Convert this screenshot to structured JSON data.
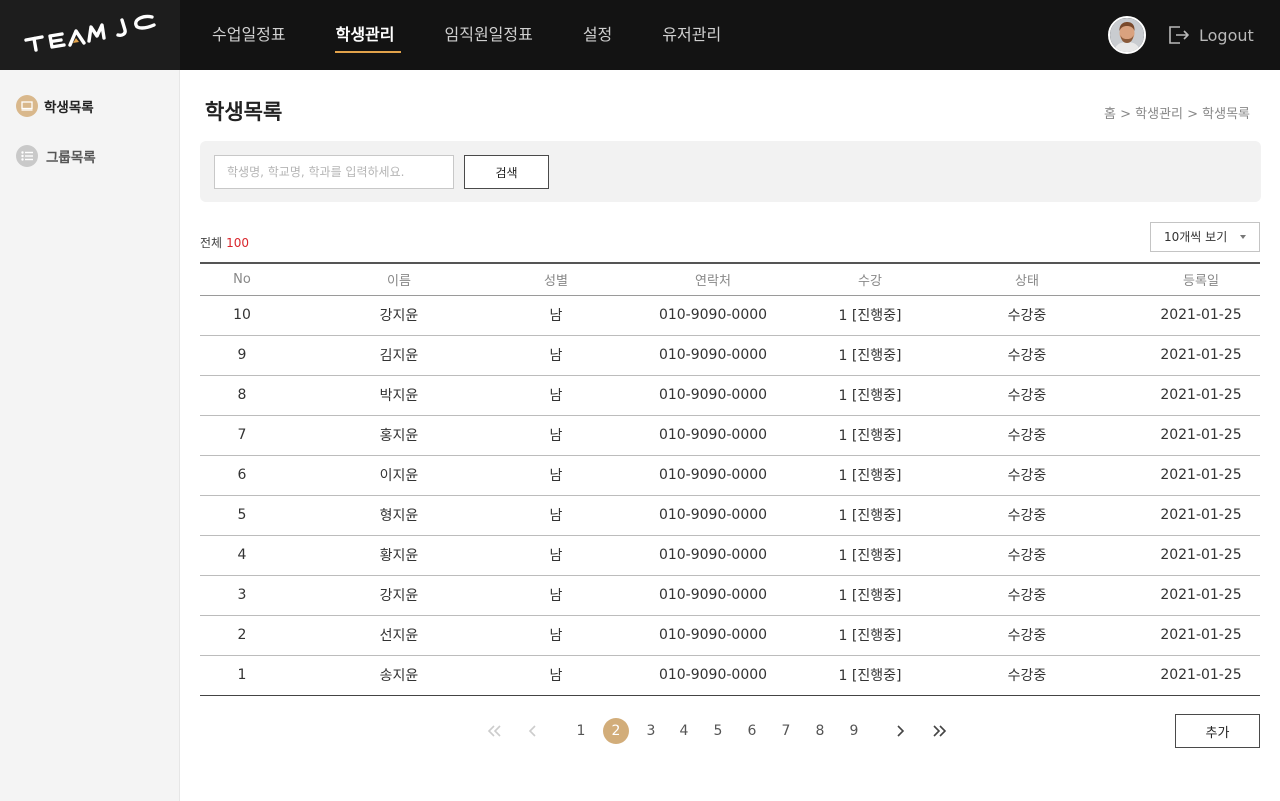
{
  "header": {
    "logo": "TEAMJC",
    "nav": [
      {
        "label": "수업일정표"
      },
      {
        "label": "학생관리"
      },
      {
        "label": "임직원일정표"
      },
      {
        "label": "설정"
      },
      {
        "label": "유저관리"
      }
    ],
    "active_nav": "학생관리",
    "logout_label": "Logout"
  },
  "sidebar": {
    "items": [
      {
        "label": "학생목록",
        "icon": "book-icon"
      },
      {
        "label": "그룹목록",
        "icon": "list-icon"
      }
    ]
  },
  "main": {
    "title": "학생목록",
    "breadcrumb": "홈 > 학생관리 > 학생목록",
    "search": {
      "placeholder": "학생명, 학교명, 학과를 입력하세요.",
      "value": "",
      "button_label": "검색"
    },
    "total_label": "전체",
    "total_count": "100",
    "page_size_label": "10개씩 보기",
    "table": {
      "columns": [
        "No",
        "이름",
        "성별",
        "연락처",
        "수강",
        "상태",
        "등록일"
      ],
      "rows": [
        [
          "10",
          "강지윤",
          "남",
          "010-9090-0000",
          "1 [진행중]",
          "수강중",
          "2021-01-25"
        ],
        [
          "9",
          "김지윤",
          "남",
          "010-9090-0000",
          "1 [진행중]",
          "수강중",
          "2021-01-25"
        ],
        [
          "8",
          "박지윤",
          "남",
          "010-9090-0000",
          "1 [진행중]",
          "수강중",
          "2021-01-25"
        ],
        [
          "7",
          "홍지윤",
          "남",
          "010-9090-0000",
          "1 [진행중]",
          "수강중",
          "2021-01-25"
        ],
        [
          "6",
          "이지윤",
          "남",
          "010-9090-0000",
          "1 [진행중]",
          "수강중",
          "2021-01-25"
        ],
        [
          "5",
          "형지윤",
          "남",
          "010-9090-0000",
          "1 [진행중]",
          "수강중",
          "2021-01-25"
        ],
        [
          "4",
          "황지윤",
          "남",
          "010-9090-0000",
          "1 [진행중]",
          "수강중",
          "2021-01-25"
        ],
        [
          "3",
          "강지윤",
          "남",
          "010-9090-0000",
          "1 [진행중]",
          "수강중",
          "2021-01-25"
        ],
        [
          "2",
          "선지윤",
          "남",
          "010-9090-0000",
          "1 [진행중]",
          "수강중",
          "2021-01-25"
        ],
        [
          "1",
          "송지윤",
          "남",
          "010-9090-0000",
          "1 [진행중]",
          "수강중",
          "2021-01-25"
        ]
      ]
    },
    "pagination": {
      "pages": [
        "1",
        "2",
        "3",
        "4",
        "5",
        "6",
        "7",
        "8",
        "9"
      ],
      "current": "2"
    },
    "add_label": "추가"
  },
  "colors": {
    "accent": "#d2ad7a",
    "nav_underline": "#e2a24a",
    "total_count": "#d9262c",
    "topbar": "#131313"
  }
}
